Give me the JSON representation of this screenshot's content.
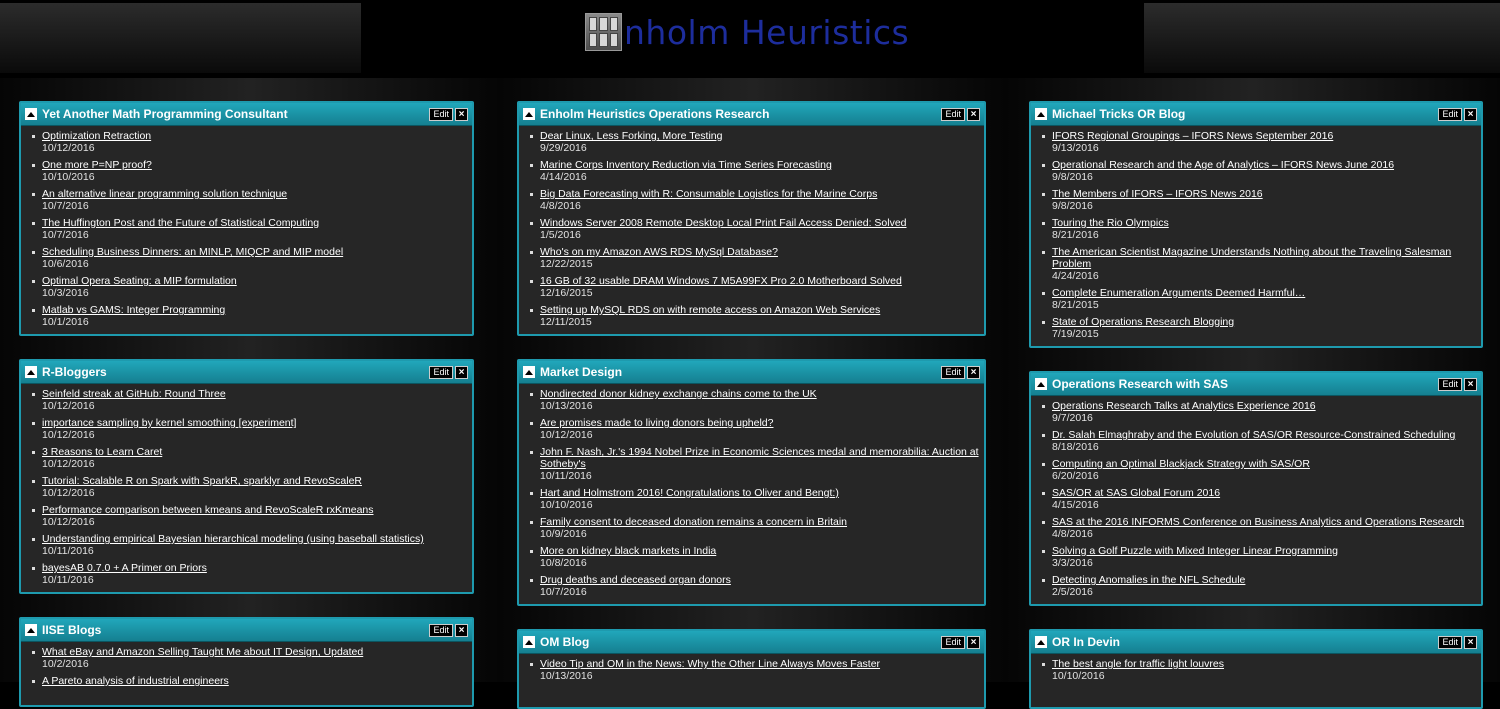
{
  "header": {
    "logo_text": "nholm Heuristics"
  },
  "controls": {
    "edit_label": "Edit",
    "close_label": "×"
  },
  "widgets": [
    {
      "title": "Yet Another Math Programming Consultant",
      "items": [
        {
          "title": "Optimization Retraction",
          "date": "10/12/2016"
        },
        {
          "title": "One more P=NP proof?",
          "date": "10/10/2016"
        },
        {
          "title": "An alternative linear programming solution technique",
          "date": "10/7/2016"
        },
        {
          "title": "The Huffington Post and the Future of Statistical Computing",
          "date": "10/7/2016"
        },
        {
          "title": "Scheduling Business Dinners: an MINLP, MIQCP and MIP model",
          "date": "10/6/2016"
        },
        {
          "title": "Optimal Opera Seating: a MIP formulation",
          "date": "10/3/2016"
        },
        {
          "title": "Matlab vs GAMS: Integer Programming",
          "date": "10/1/2016"
        }
      ]
    },
    {
      "title": "R-Bloggers",
      "items": [
        {
          "title": "Seinfeld streak at GitHub: Round Three",
          "date": "10/12/2016"
        },
        {
          "title": "importance sampling by kernel smoothing [experiment]",
          "date": "10/12/2016"
        },
        {
          "title": "3 Reasons to Learn Caret",
          "date": "10/12/2016"
        },
        {
          "title": "Tutorial: Scalable R on Spark with SparkR, sparklyr and RevoScaleR",
          "date": "10/12/2016"
        },
        {
          "title": "Performance comparison between kmeans and RevoScaleR rxKmeans",
          "date": "10/12/2016"
        },
        {
          "title": "Understanding empirical Bayesian hierarchical modeling (using baseball statistics)",
          "date": "10/11/2016"
        },
        {
          "title": "bayesAB 0.7.0 + A Primer on Priors",
          "date": "10/11/2016"
        }
      ]
    },
    {
      "title": "IISE Blogs",
      "items": [
        {
          "title": "What eBay and Amazon Selling Taught Me about IT Design, Updated",
          "date": "10/2/2016"
        },
        {
          "title": "A Pareto analysis of industrial engineers",
          "date": ""
        }
      ]
    },
    {
      "title": "Enholm Heuristics Operations Research",
      "items": [
        {
          "title": "Dear Linux, Less Forking, More Testing",
          "date": "9/29/2016"
        },
        {
          "title": "Marine Corps Inventory Reduction via Time Series Forecasting",
          "date": "4/14/2016"
        },
        {
          "title": "Big Data Forecasting with R: Consumable Logistics for the Marine Corps",
          "date": "4/8/2016"
        },
        {
          "title": "Windows Server 2008 Remote Desktop Local Print Fail Access Denied: Solved",
          "date": "1/5/2016"
        },
        {
          "title": "Who's on my Amazon AWS RDS MySql Database?",
          "date": "12/22/2015"
        },
        {
          "title": "16 GB of 32 usable DRAM Windows 7 M5A99FX Pro 2.0 Motherboard Solved",
          "date": "12/16/2015"
        },
        {
          "title": "Setting up MySQL RDS on with remote access on Amazon Web Services",
          "date": "12/11/2015"
        }
      ]
    },
    {
      "title": "Market Design",
      "items": [
        {
          "title": "Nondirected donor kidney exchange chains come to the UK",
          "date": "10/13/2016"
        },
        {
          "title": "Are promises made to living donors being upheld?",
          "date": "10/12/2016"
        },
        {
          "title": "John F. Nash, Jr.'s 1994 Nobel Prize in Economic Sciences medal and memorabilia: Auction at Sotheby's",
          "date": "10/11/2016"
        },
        {
          "title": "Hart and Holmstrom 2016! Congratulations to Oliver and Bengt:)",
          "date": "10/10/2016"
        },
        {
          "title": "Family consent to deceased donation remains a concern in Britain",
          "date": "10/9/2016"
        },
        {
          "title": "More on kidney black markets in India",
          "date": "10/8/2016"
        },
        {
          "title": "Drug deaths and deceased organ donors",
          "date": "10/7/2016"
        }
      ]
    },
    {
      "title": "OM Blog",
      "items": [
        {
          "title": "Video Tip and OM in the News: Why the Other Line Always Moves Faster",
          "date": "10/13/2016"
        }
      ]
    },
    {
      "title": "Michael Tricks OR Blog",
      "items": [
        {
          "title": "IFORS Regional Groupings – IFORS News September 2016",
          "date": "9/13/2016"
        },
        {
          "title": "Operational Research and the Age of Analytics – IFORS News June 2016",
          "date": "9/8/2016"
        },
        {
          "title": "The Members of IFORS – IFORS News 2016",
          "date": "9/8/2016"
        },
        {
          "title": "Touring the Rio Olympics",
          "date": "8/21/2016"
        },
        {
          "title": "The American Scientist Magazine Understands Nothing about the Traveling Salesman Problem",
          "date": "4/24/2016"
        },
        {
          "title": "Complete Enumeration Arguments Deemed Harmful…",
          "date": "8/21/2015"
        },
        {
          "title": "State of Operations Research Blogging",
          "date": "7/19/2015"
        }
      ]
    },
    {
      "title": "Operations Research with SAS",
      "items": [
        {
          "title": "Operations Research Talks at Analytics Experience 2016",
          "date": "9/7/2016"
        },
        {
          "title": "Dr. Salah Elmaghraby and the Evolution of SAS/OR Resource-Constrained Scheduling",
          "date": "8/18/2016"
        },
        {
          "title": "Computing an Optimal Blackjack Strategy with SAS/OR",
          "date": "6/20/2016"
        },
        {
          "title": "SAS/OR at SAS Global Forum 2016",
          "date": "4/15/2016"
        },
        {
          "title": "SAS at the 2016 INFORMS Conference on Business Analytics and Operations Research",
          "date": "4/8/2016"
        },
        {
          "title": "Solving a Golf Puzzle with Mixed Integer Linear Programming",
          "date": "3/3/2016"
        },
        {
          "title": "Detecting Anomalies in the NFL Schedule",
          "date": "2/5/2016"
        }
      ]
    },
    {
      "title": "OR In Devin",
      "items": [
        {
          "title": "The best angle for traffic light louvres",
          "date": "10/10/2016"
        }
      ]
    }
  ]
}
